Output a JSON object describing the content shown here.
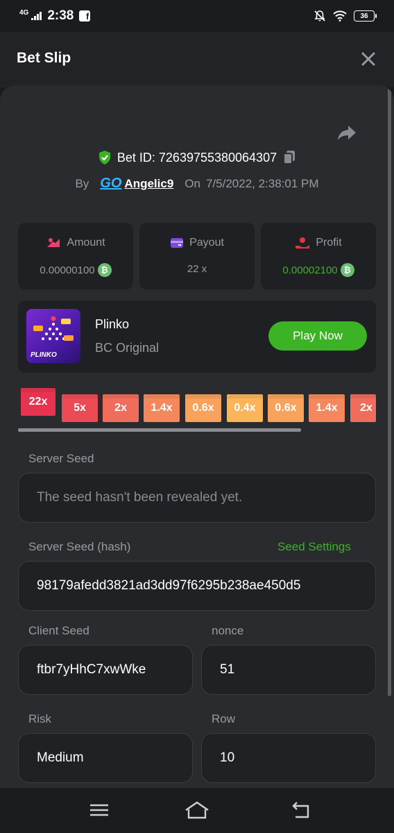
{
  "status_bar": {
    "network": "4G",
    "time": "2:38",
    "battery": "36"
  },
  "header": {
    "title": "Bet Slip"
  },
  "bet": {
    "id_label": "Bet ID: 726397553800643​07",
    "by_label": "By",
    "logo": "GO",
    "user": "Angelic9",
    "on_label": "On",
    "datetime": "7/5/2022, 2:38:01 PM"
  },
  "stats": {
    "amount": {
      "label": "Amount",
      "value_main": "0.00000100",
      "value_dim": "00"
    },
    "payout": {
      "label": "Payout",
      "value": "22 x"
    },
    "profit": {
      "label": "Profit",
      "value_main": "0.00002100",
      "value_dim": "00"
    }
  },
  "game": {
    "name": "Plinko",
    "subtitle": "BC Original",
    "play_label": "Play Now",
    "thumb_text": "PLINKO"
  },
  "multipliers": [
    "22x",
    "5x",
    "2x",
    "1.4x",
    "0.6x",
    "0.4x",
    "0.6x",
    "1.4x",
    "2x"
  ],
  "colors": {
    "accent_green": "#3cb325",
    "coin": "#6bbf73"
  },
  "server_seed": {
    "label": "Server Seed",
    "placeholder": "The seed hasn't been revealed yet."
  },
  "server_seed_hash": {
    "label": "Server Seed (hash)",
    "settings_link": "Seed Settings",
    "value": "98179afedd3821ad3dd97f6295b238ae450d5"
  },
  "client_seed": {
    "label": "Client Seed",
    "value": "ftbr7yHhC7xwWke"
  },
  "nonce": {
    "label": "nonce",
    "value": "51"
  },
  "risk": {
    "label": "Risk",
    "value": "Medium"
  },
  "row": {
    "label": "Row",
    "value": "10"
  }
}
